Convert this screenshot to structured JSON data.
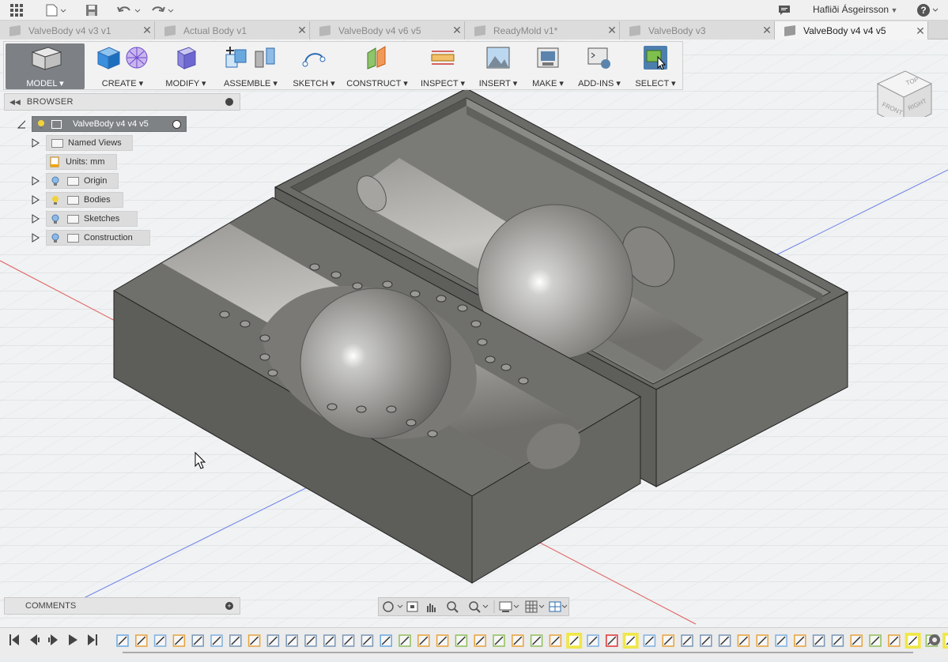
{
  "app": {
    "user": "Hafliði Ásgeirsson"
  },
  "tabs": [
    {
      "label": "ValveBody v4 v3 v1",
      "active": false
    },
    {
      "label": "Actual Body v1",
      "active": false
    },
    {
      "label": "ValveBody v4 v6 v5",
      "active": false
    },
    {
      "label": "ReadyMold v1*",
      "active": false
    },
    {
      "label": "ValveBody v3",
      "active": false
    },
    {
      "label": "ValveBody v4 v4 v5",
      "active": true
    }
  ],
  "toolbar": {
    "model": "MODEL ▾",
    "create": "CREATE ▾",
    "modify": "MODIFY ▾",
    "assemble": "ASSEMBLE ▾",
    "sketch": "SKETCH ▾",
    "construct": "CONSTRUCT ▾",
    "inspect": "INSPECT ▾",
    "insert": "INSERT ▾",
    "make": "MAKE ▾",
    "addins": "ADD-INS ▾",
    "select": "SELECT ▾"
  },
  "browser": {
    "title": "BROWSER",
    "root": "ValveBody v4 v4 v5",
    "named_views": "Named Views",
    "units": "Units: mm",
    "origin": "Origin",
    "bodies": "Bodies",
    "sketches": "Sketches",
    "construction": "Construction"
  },
  "viewcube": {
    "top": "TOP",
    "front": "FRONT",
    "right": "RIGHT"
  },
  "comments": {
    "title": "COMMENTS"
  },
  "colors": {
    "accent": "#4d7fae",
    "selected": "#5a84ad",
    "body": "#7a7a78",
    "highlight": "#f0e64a"
  }
}
